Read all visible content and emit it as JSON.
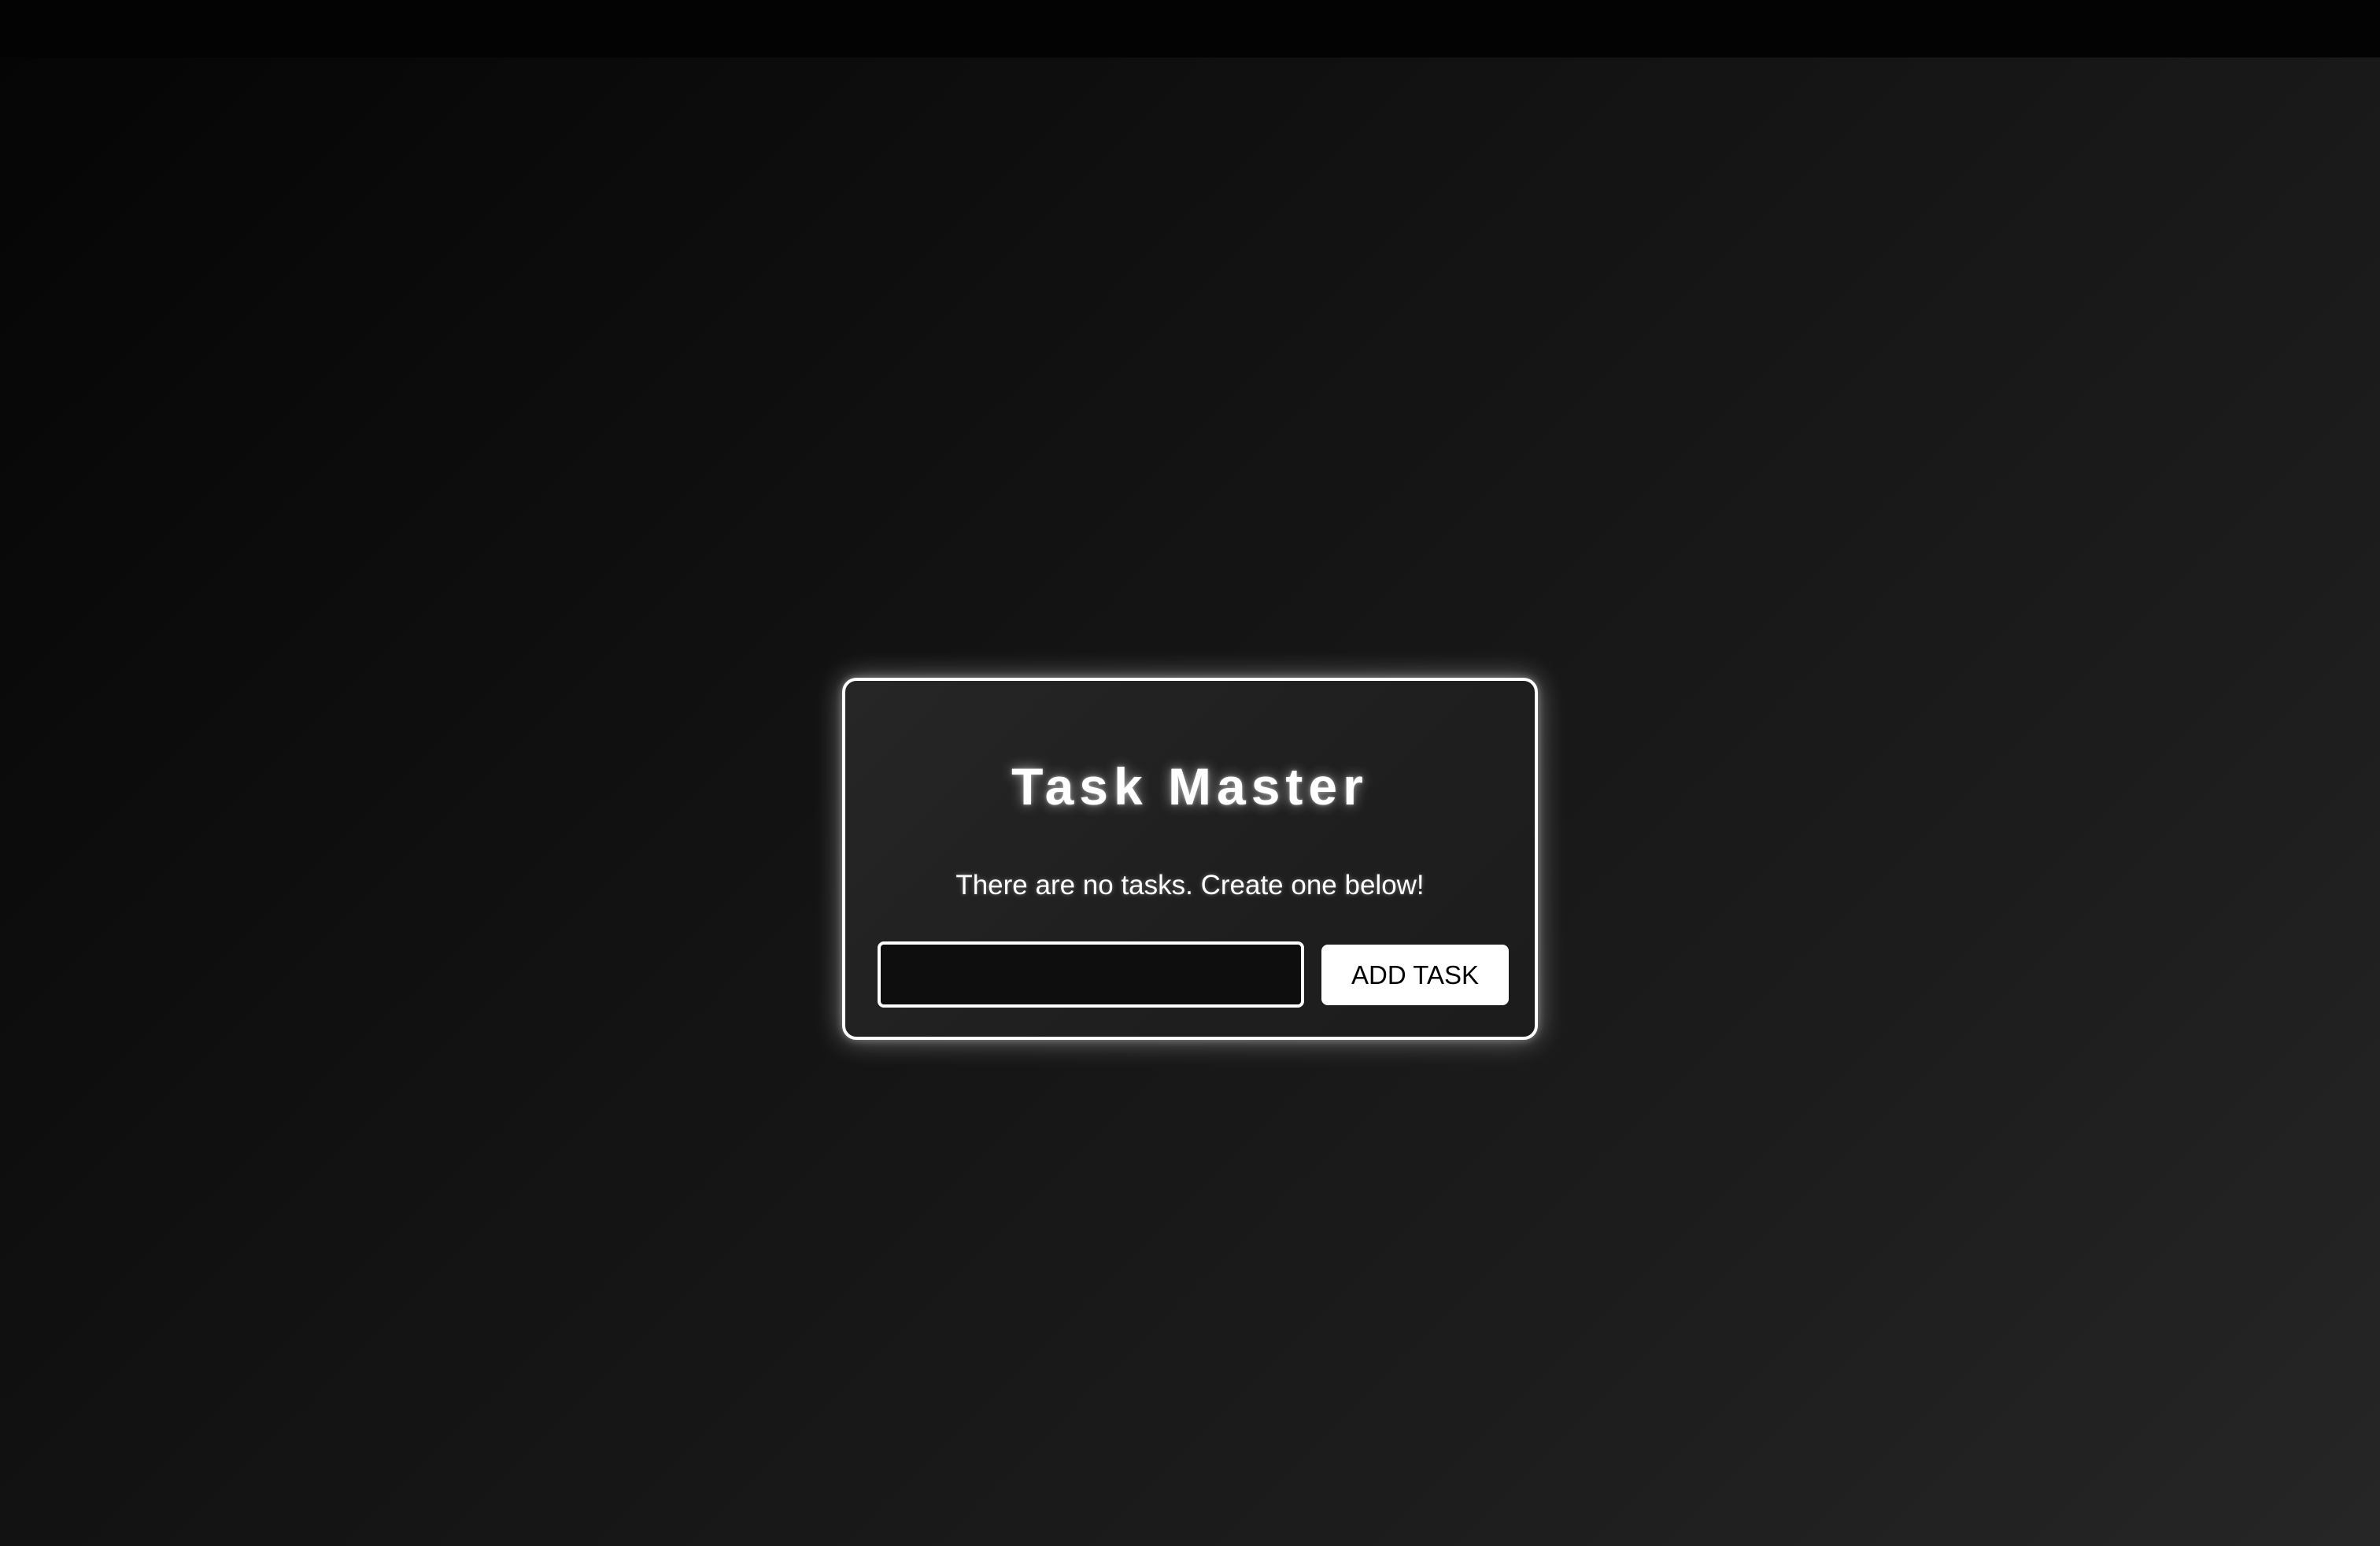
{
  "app": {
    "title": "Task Master",
    "empty_message": "There are no tasks. Create one below!"
  },
  "form": {
    "input_value": "",
    "add_button_label": "ADD TASK"
  },
  "colors": {
    "accent": "#ffffff",
    "background_dark": "#050505",
    "background_light": "#262626",
    "input_background": "#0e0e0e"
  }
}
